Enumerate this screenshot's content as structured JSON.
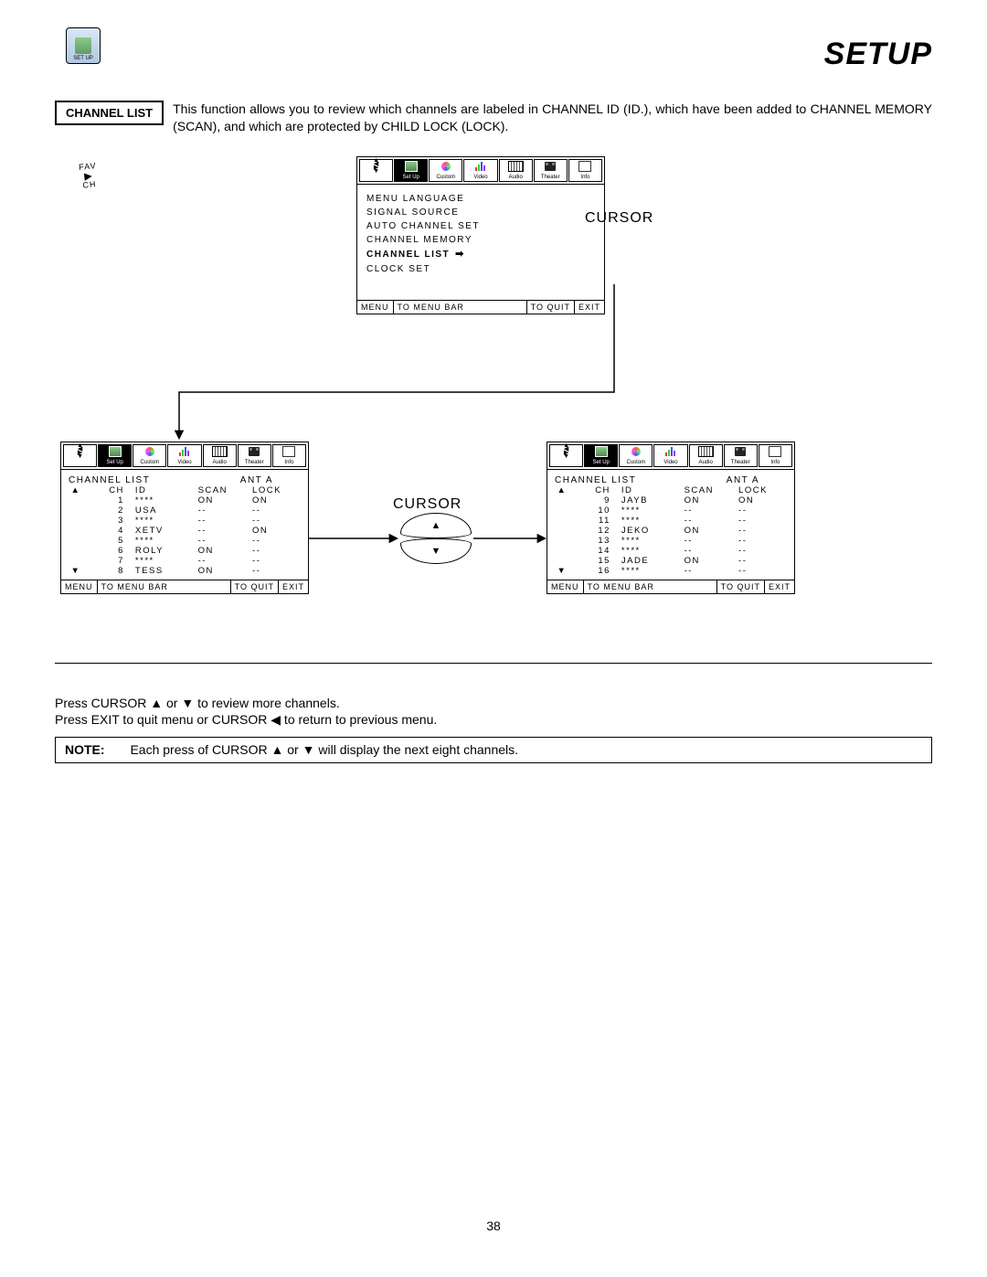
{
  "header": {
    "title": "SETUP",
    "icon_label": "SET UP"
  },
  "intro": {
    "label": "CHANNEL LIST",
    "text": "This function allows you to review which channels are labeled in CHANNEL ID (ID.), which have been added to CHANNEL MEMORY (SCAN), and which are protected by CHILD LOCK (LOCK)."
  },
  "menu_icons": [
    {
      "label": " ",
      "kind": "cursor"
    },
    {
      "label": "Set Up",
      "kind": "setup",
      "selected": true
    },
    {
      "label": "Custom",
      "kind": "custom"
    },
    {
      "label": "Video",
      "kind": "video"
    },
    {
      "label": "Audio",
      "kind": "audio"
    },
    {
      "label": "Theater",
      "kind": "theater"
    },
    {
      "label": "Info",
      "kind": "info"
    }
  ],
  "main_menu": {
    "items": [
      {
        "text": "MENU LANGUAGE",
        "sel": false
      },
      {
        "text": "SIGNAL SOURCE",
        "sel": false
      },
      {
        "text": "AUTO CHANNEL SET",
        "sel": false
      },
      {
        "text": "CHANNEL MEMORY",
        "sel": false
      },
      {
        "text": "CHANNEL LIST",
        "sel": true,
        "arrow": "➡"
      },
      {
        "text": "CLOCK SET",
        "sel": false
      }
    ],
    "footer": {
      "menu": "MENU",
      "tomenu": "TO MENU BAR",
      "toquit": "TO QUIT",
      "exit": "EXIT"
    }
  },
  "cursor_right": {
    "title": "CURSOR",
    "l1": "FAV",
    "l2": "▶",
    "l3": "CH"
  },
  "cursor_updown": {
    "title": "CURSOR",
    "up": "▲",
    "down": "▼"
  },
  "list_left": {
    "title": "CHANNEL LIST",
    "ant": "ANT A",
    "headers": {
      "ch": "CH",
      "id": "ID",
      "scan": "SCAN",
      "lock": "LOCK"
    },
    "rows": [
      {
        "ch": "1",
        "id": "****",
        "scan": "ON",
        "lock": "ON"
      },
      {
        "ch": "2",
        "id": "USA",
        "scan": "--",
        "lock": "--"
      },
      {
        "ch": "3",
        "id": "****",
        "scan": "--",
        "lock": "--"
      },
      {
        "ch": "4",
        "id": "XETV",
        "scan": "--",
        "lock": "ON"
      },
      {
        "ch": "5",
        "id": "****",
        "scan": "--",
        "lock": "--"
      },
      {
        "ch": "6",
        "id": "ROLY",
        "scan": "ON",
        "lock": "--"
      },
      {
        "ch": "7",
        "id": "****",
        "scan": "--",
        "lock": "--"
      },
      {
        "ch": "8",
        "id": "TESS",
        "scan": "ON",
        "lock": "--"
      }
    ]
  },
  "list_right": {
    "title": "CHANNEL LIST",
    "ant": "ANT A",
    "headers": {
      "ch": "CH",
      "id": "ID",
      "scan": "SCAN",
      "lock": "LOCK"
    },
    "rows": [
      {
        "ch": "9",
        "id": "JAYB",
        "scan": "ON",
        "lock": "ON"
      },
      {
        "ch": "10",
        "id": "****",
        "scan": "--",
        "lock": "--"
      },
      {
        "ch": "11",
        "id": "****",
        "scan": "--",
        "lock": "--"
      },
      {
        "ch": "12",
        "id": "JEKO",
        "scan": "ON",
        "lock": "--"
      },
      {
        "ch": "13",
        "id": "****",
        "scan": "--",
        "lock": "--"
      },
      {
        "ch": "14",
        "id": "****",
        "scan": "--",
        "lock": "--"
      },
      {
        "ch": "15",
        "id": "JADE",
        "scan": "ON",
        "lock": "--"
      },
      {
        "ch": "16",
        "id": "****",
        "scan": "--",
        "lock": "--"
      }
    ]
  },
  "bottom": {
    "line1_a": "Press CURSOR ",
    "line1_b": " or ",
    "line1_c": " to review more channels.",
    "line2_a": "Press EXIT to quit menu or CURSOR ",
    "line2_b": " to return to previous menu.",
    "up": "▲",
    "down": "▼",
    "left": "◀",
    "note_label": "NOTE:",
    "note_a": "Each press of CURSOR ",
    "note_b": " or ",
    "note_c": " will display the next eight channels."
  },
  "page_number": "38"
}
